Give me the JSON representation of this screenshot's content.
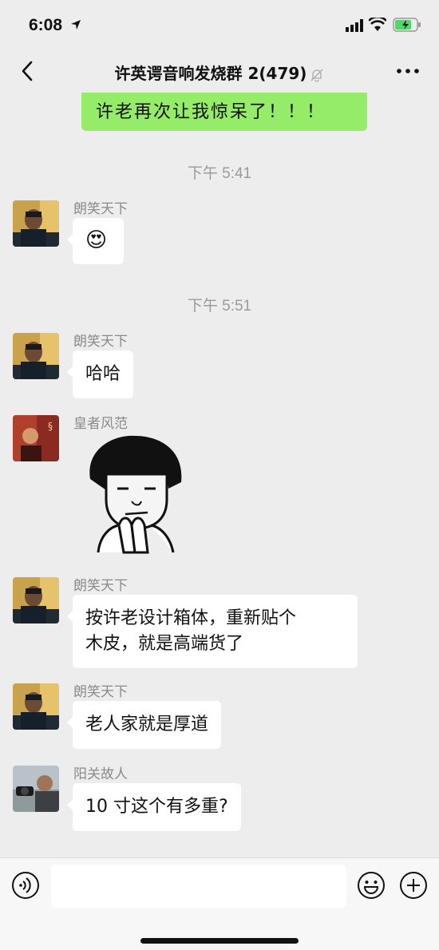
{
  "status": {
    "time": "6:08"
  },
  "header": {
    "title": "许英谔音响发烧群 2(479)"
  },
  "messages": {
    "self_text": "许老再次让我惊呆了！！！",
    "time1": "下午 5:41",
    "time2": "下午 5:51",
    "m1": {
      "sender": "朗笑天下",
      "emoji": "😍"
    },
    "m2": {
      "sender": "朗笑天下",
      "text": "哈哈"
    },
    "m3": {
      "sender": "皇者风范"
    },
    "m4": {
      "sender": "朗笑天下",
      "line1": "按许老设计箱体，重新贴个",
      "line2": "木皮，就是高端货了"
    },
    "m5": {
      "sender": "朗笑天下",
      "text": "老人家就是厚道"
    },
    "m6": {
      "sender": "阳关故人",
      "text": "10 寸这个有多重?"
    }
  },
  "colors": {
    "self_bubble": "#95ec69",
    "background": "#ededed"
  }
}
